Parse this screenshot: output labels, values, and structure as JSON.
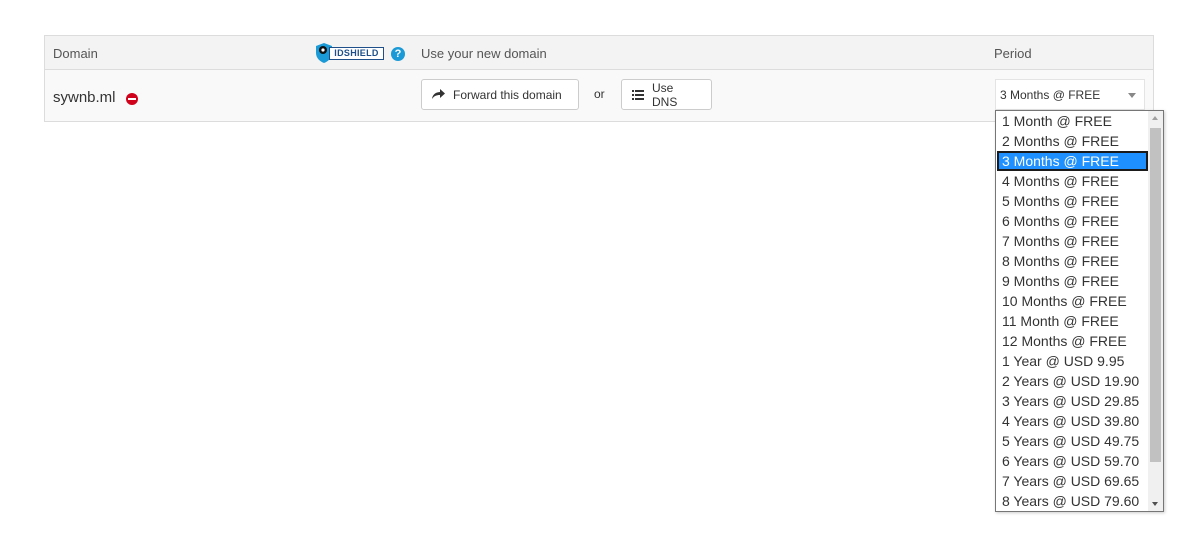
{
  "table": {
    "headers": {
      "domain": "Domain",
      "use_domain": "Use your new domain",
      "period": "Period"
    },
    "idshield": {
      "label": "IDSHIELD",
      "help": "?"
    },
    "row": {
      "domain": "sywnb.ml",
      "forward_label": "Forward this domain",
      "or_text": "or",
      "dns_label": "Use DNS",
      "period_selected": "3 Months @ FREE"
    }
  },
  "dropdown": {
    "options": [
      "1 Month @ FREE",
      "2 Months @ FREE",
      "3 Months @ FREE",
      "4 Months @ FREE",
      "5 Months @ FREE",
      "6 Months @ FREE",
      "7 Months @ FREE",
      "8 Months @ FREE",
      "9 Months @ FREE",
      "10 Months @ FREE",
      "11 Month @ FREE",
      "12 Months @ FREE",
      "1 Year @ USD 9.95",
      "2 Years @ USD 19.90",
      "3 Years @ USD 29.85",
      "4 Years @ USD 39.80",
      "5 Years @ USD 49.75",
      "6 Years @ USD 59.70",
      "7 Years @ USD 69.65",
      "8 Years @ USD 79.60"
    ],
    "selected_index": 2
  },
  "icons": {
    "remove": "minus-circle-icon",
    "forward": "share-arrow-icon",
    "dns": "list-icon",
    "help": "question-circle-icon",
    "shield": "shield-icon"
  },
  "colors": {
    "selected_bg": "#1e90ff",
    "remove_red": "#d0021b",
    "help_blue": "#1a9ad6"
  }
}
